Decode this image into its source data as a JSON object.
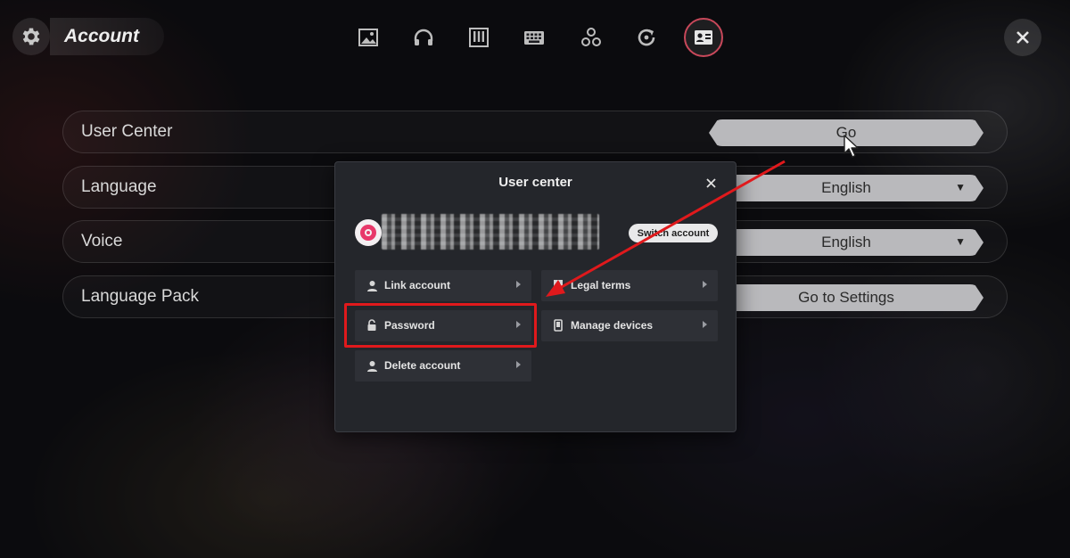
{
  "header": {
    "title": "Account",
    "settings_icon": "gear-icon",
    "close_icon": "close-icon"
  },
  "tabs": [
    {
      "name": "image-icon",
      "active": false
    },
    {
      "name": "headphones-icon",
      "active": false
    },
    {
      "name": "piano-keys-icon",
      "active": false
    },
    {
      "name": "keyboard-icon",
      "active": false
    },
    {
      "name": "nodes-icon",
      "active": false
    },
    {
      "name": "refresh-icon",
      "active": false
    },
    {
      "name": "id-card-icon",
      "active": true
    }
  ],
  "rows": [
    {
      "label": "User Center",
      "control": "Go",
      "type": "button"
    },
    {
      "label": "Language",
      "control": "English",
      "type": "select"
    },
    {
      "label": "Voice",
      "control": "English",
      "type": "select"
    },
    {
      "label": "Language Pack",
      "control": "Go to Settings",
      "type": "button"
    }
  ],
  "modal": {
    "title": "User center",
    "switch_account": "Switch account",
    "items": [
      {
        "label": "Link account",
        "icon": "user-icon"
      },
      {
        "label": "Legal terms",
        "icon": "document-icon"
      },
      {
        "label": "Password",
        "icon": "lock-icon"
      },
      {
        "label": "Manage devices",
        "icon": "phone-icon"
      },
      {
        "label": "Delete account",
        "icon": "user-icon"
      }
    ]
  },
  "colors": {
    "highlight": "#e0191c",
    "accent_active_tab": "#c8485a",
    "control_bg": "#b9b9bc",
    "modal_bg": "#24262b"
  }
}
